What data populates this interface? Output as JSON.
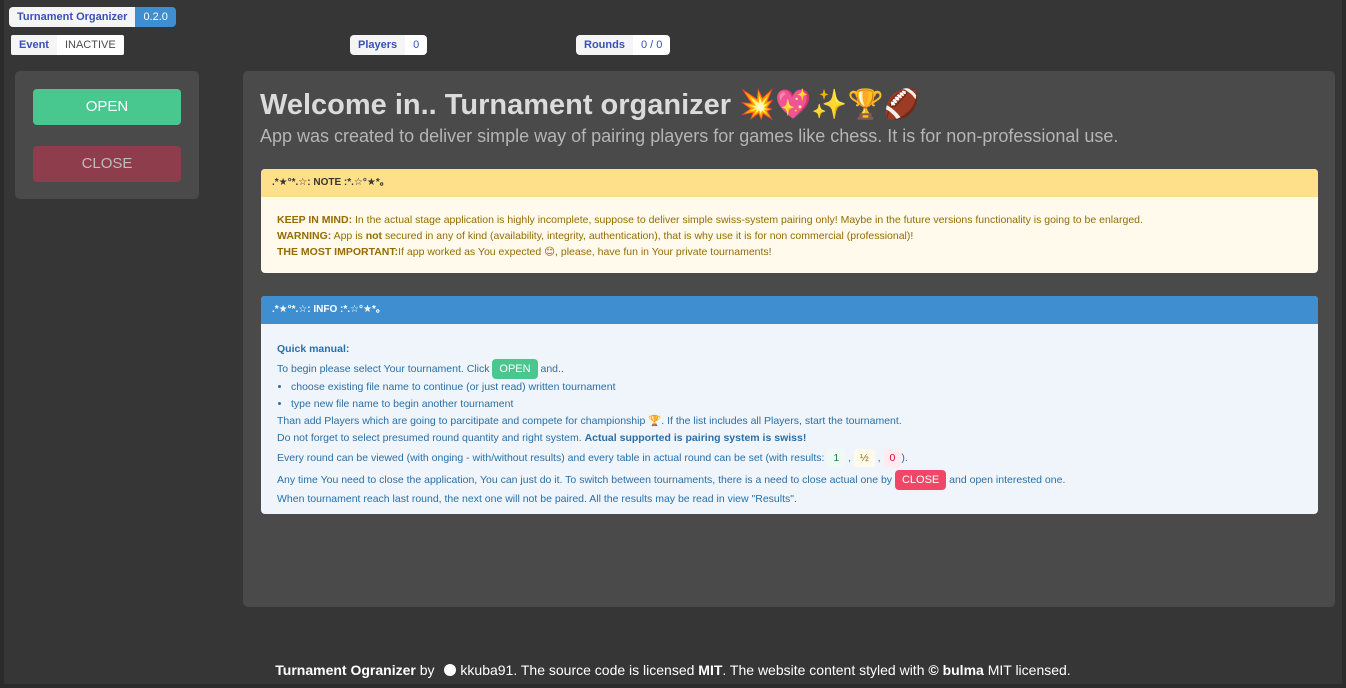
{
  "header": {
    "app_name": "Turnament Organizer",
    "version": "0.2.0",
    "event_label": "Event",
    "event_status": "INACTIVE",
    "players_label": "Players",
    "players_count": "0",
    "rounds_label": "Rounds",
    "rounds_value": "0 / 0"
  },
  "sidebar": {
    "open_label": "OPEN",
    "close_label": "CLOSE"
  },
  "main": {
    "title": "Welcome in.. Turnament organizer 💥💖✨🏆🏈",
    "subtitle": "App was created to deliver simple way of pairing players for games like chess. It is for non-professional use."
  },
  "note": {
    "header": ".*★°*.☆: NOTE :*.☆°★*｡",
    "keep_label": "KEEP IN MIND:",
    "keep_text": " In the actual stage application is highly incomplete, suppose to deliver simple swiss-system pairing only! Maybe in the future versions functionality is going to be enlarged.",
    "warning_label": "WARNING:",
    "warning_pre": " App is ",
    "warning_not": "not",
    "warning_post": " secured in any of kind (availability, integrity, authentication), that is why use it is for non commercial (professional)!",
    "important_label": "THE MOST IMPORTANT:",
    "important_text": "If app worked as You expected 😊, please, have fun in Your private tournaments!"
  },
  "info": {
    "header": ".*★°*.☆: INFO :*.☆°★*｡",
    "quick_manual": "Quick manual:",
    "begin_pre": "To begin please select Your tournament. Click ",
    "open_pill": "OPEN",
    "begin_post": " and..",
    "bullets": [
      "choose existing file name to continue (or just read) written tournament",
      "type new file name to begin another tournament"
    ],
    "players_line": "Than add Players which are going to parcitipate and compete for championship 🏆. If the list includes all Players, start the tournament.",
    "system_pre": "Do not forget to select presumed round quantity and right system. ",
    "system_bold": "Actual supported is pairing system is swiss!",
    "results_pre": "Every round can be viewed (with onging - with/without results) and every table in actual round can be set (with results: ",
    "result_win": "1",
    "result_draw": "½",
    "result_loss": "0",
    "results_post": ").",
    "close_pre": "Any time You need to close the application, You can just do it. To switch between tournaments, there is a need to close actual one by ",
    "close_pill": "CLOSE",
    "close_post": " and open interested one.",
    "last_line": "When tournament reach last round, the next one will not be paired. All the results may be read in view \"Results\"."
  },
  "footer": {
    "app_name": "Turnament Ogranizer",
    "by": " by ",
    "author": "kkuba91",
    "license_pre": ". The source code is licensed ",
    "license": "MIT",
    "content_pre": ". The website content styled with ",
    "bulma": "© bulma",
    "content_post": " MIT licensed."
  }
}
